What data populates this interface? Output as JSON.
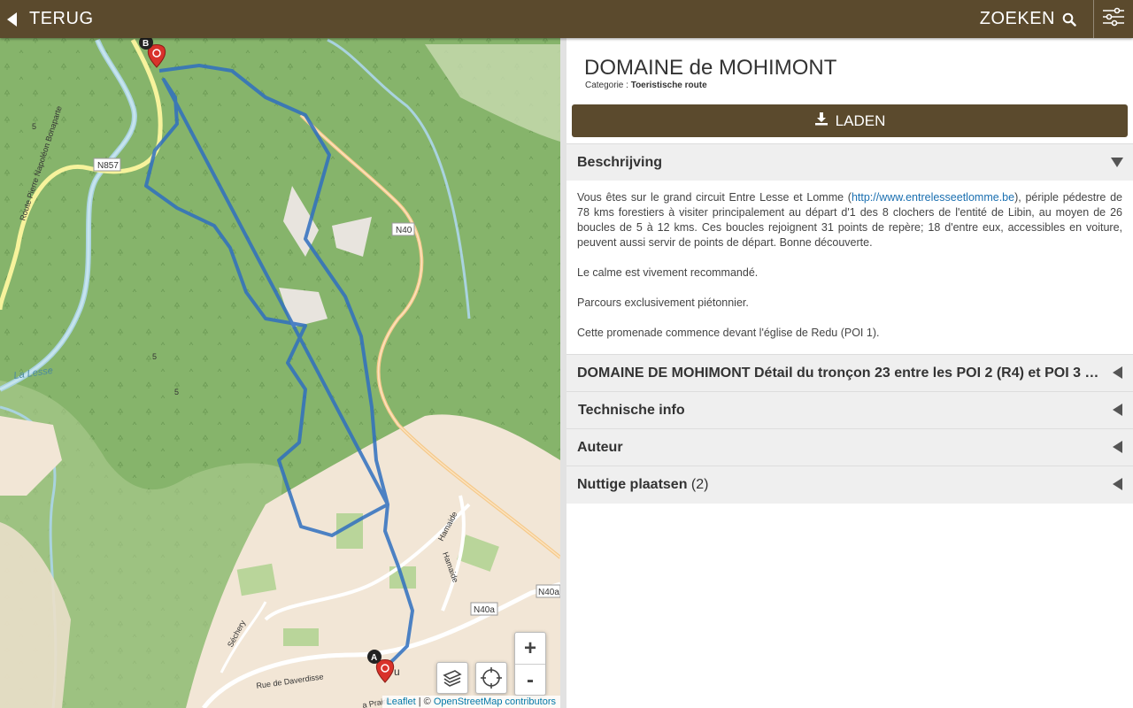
{
  "topbar": {
    "back_label": "TERUG",
    "search_label": "ZOEKEN",
    "icons": {
      "back": "back-arrow-icon",
      "search": "search-icon",
      "filter": "filter-sliders-icon"
    }
  },
  "map": {
    "labels": {
      "n857": "N857",
      "n40": "N40",
      "n40a": "N40a",
      "n40a_2": "N40a",
      "la_lesse": "La Lesse",
      "route_pierre": "Route Pierre Napoléon Bonaparte",
      "hamaide_1": "Hamaide",
      "hamaide_2": "Hamaide",
      "rue_daverdisse": "Rue de Daverdisse",
      "sechery": "Séchery",
      "n5a": "5",
      "n5b": "5",
      "n5c": "5",
      "village": "u",
      "prairie": "a Prairie"
    },
    "markers": {
      "start": "A",
      "end": "B"
    },
    "zoom_in": "+",
    "zoom_out": "-",
    "attribution": {
      "leaflet": "Leaflet",
      "separator": " | © ",
      "osm": "OpenStreetMap contributors"
    },
    "colors": {
      "route": "#2f6fc0",
      "forest": "#86b46b",
      "village": "#f2e6d6",
      "marker": "#d9322b"
    }
  },
  "detail": {
    "title": "DOMAINE de MOHIMONT",
    "category_label": "Categorie : ",
    "category_value": "Toeristische route",
    "download_label": "LADEN",
    "description_header": "Beschrijving",
    "description": {
      "p1_before": "Vous êtes sur le grand circuit Entre Lesse et Lomme (",
      "p1_link": "http://www.entrelesseetlomme.be",
      "p1_after": "), périple pédestre de 78 kms forestiers à visiter principalement au départ d'1 des 8 clochers de l'entité de Libin, au moyen de 26 boucles de 5 à 12 kms. Ces boucles rejoignent 31 points de repère; 18 d'entre eux, accessibles en voiture, peuvent aussi servir de points de départ. Bonne découverte.",
      "p2": "Le calme est vivement recommandé.",
      "p3": "Parcours exclusivement piétonnier.",
      "p4": "Cette promenade commence devant l'église de Redu (POI 1)."
    },
    "sections": {
      "troncon": "DOMAINE DE MOHIMONT Détail du tronçon 23 entre les POI 2 (R4) et POI 3 (…",
      "tech": "Technische info",
      "author": "Auteur",
      "places": "Nuttige plaatsen",
      "places_count": "(2)"
    }
  }
}
